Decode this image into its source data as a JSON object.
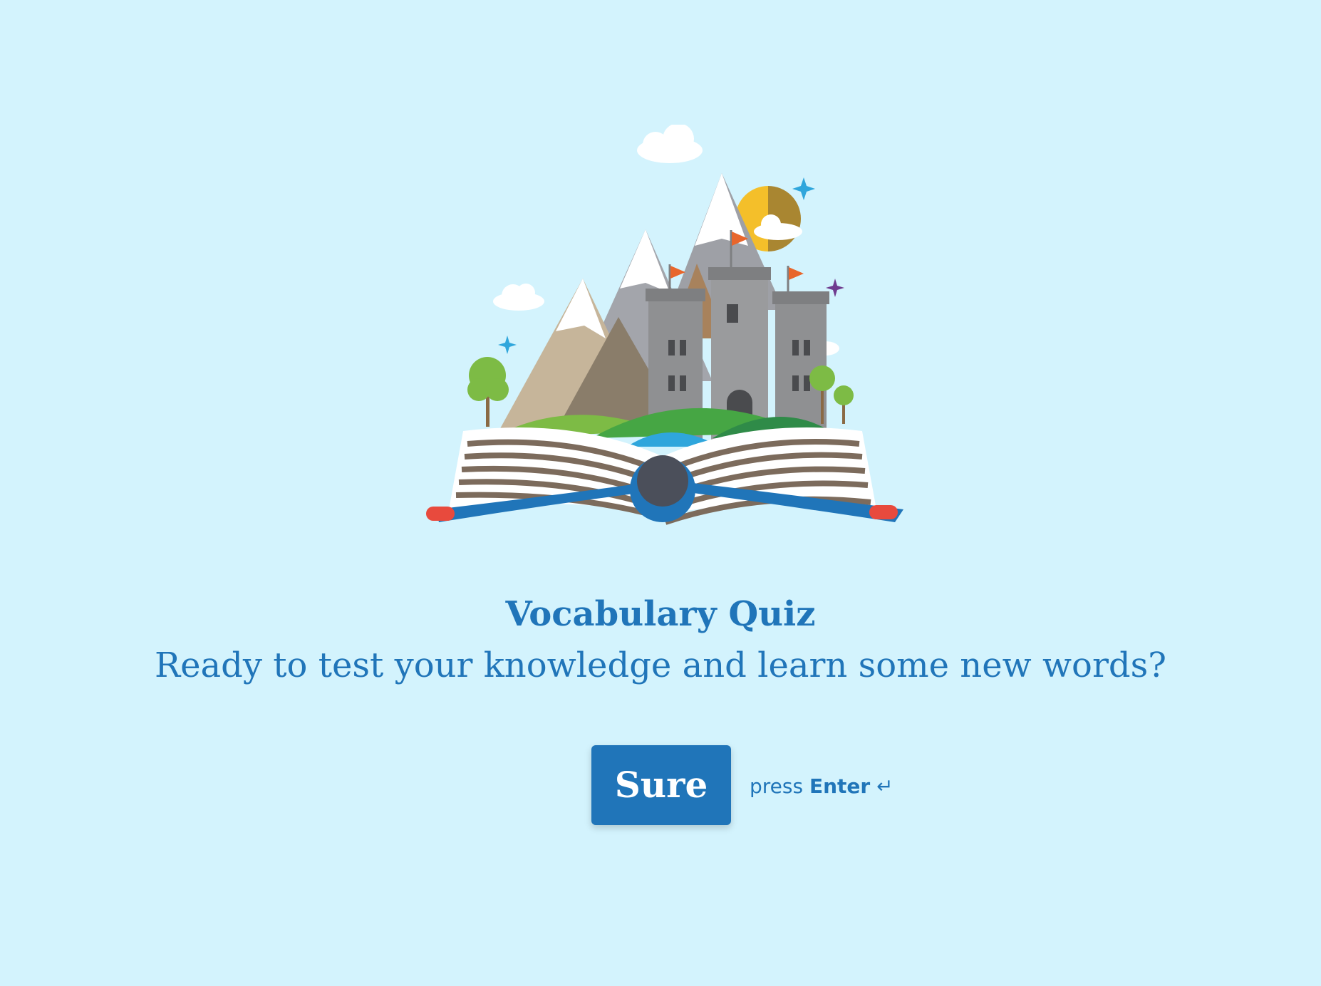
{
  "quiz": {
    "title": "Vocabulary Quiz",
    "subtitle": "Ready to test your knowledge and learn some new words?"
  },
  "start": {
    "button_label": "Sure",
    "hint_prefix": "press",
    "hint_key": "Enter",
    "hint_glyph": "↵"
  },
  "hero": {
    "icon": "open-book-castle-illustration"
  },
  "colors": {
    "background": "#d3f3fd",
    "accent": "#2075b9",
    "button_text": "#ffffff"
  }
}
